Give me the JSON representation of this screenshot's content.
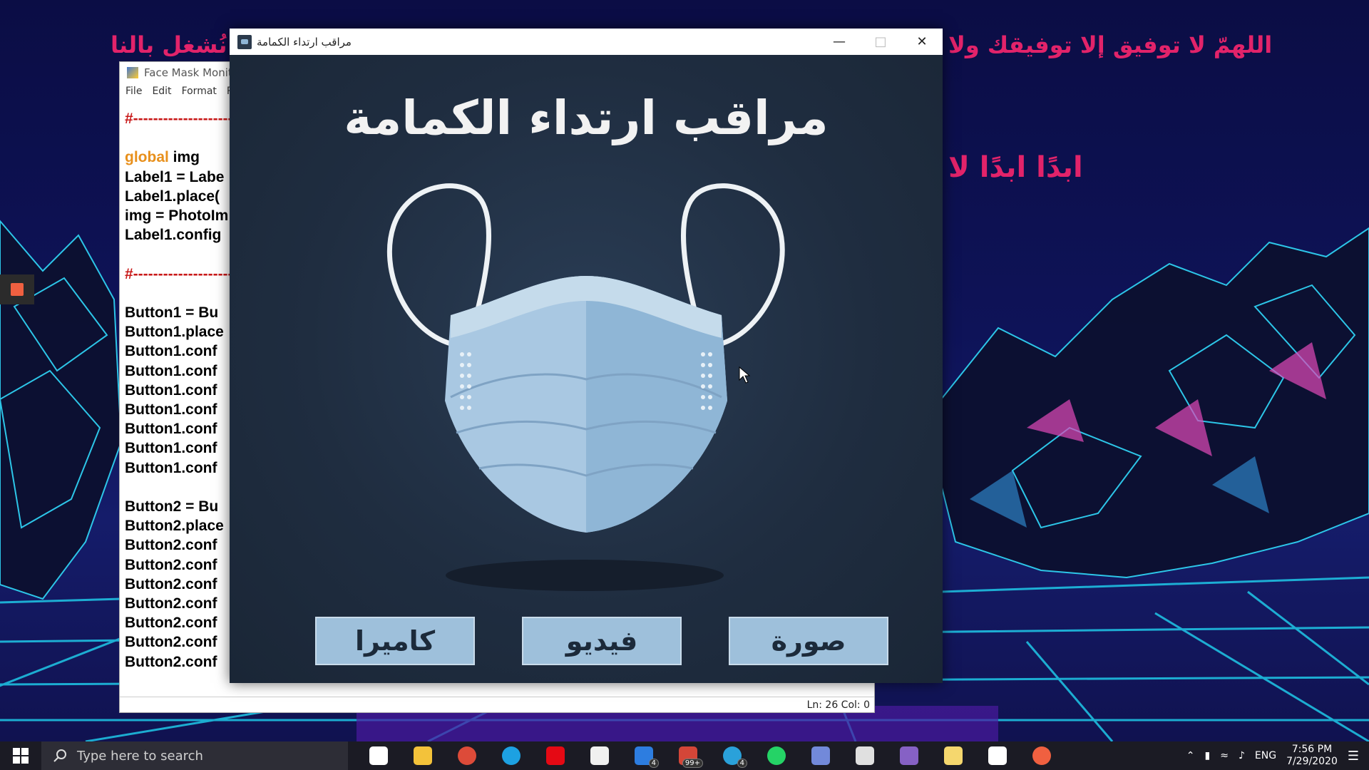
{
  "desktop": {
    "banner_left": "نُشغل بالنا",
    "banner_right": "اللهمّ لا توفيق إلا توفيقك ولا",
    "banner_second": "ابدًا ابدًا لا"
  },
  "editor": {
    "title": "Face Mask Monito",
    "menu": [
      "File",
      "Edit",
      "Format",
      "R"
    ],
    "code_lines": [
      {
        "text": "#------------------------",
        "cls": "cm"
      },
      {
        "text": "",
        "cls": ""
      },
      {
        "text": "global",
        "cls": "kw",
        "rest": " img"
      },
      {
        "text": "Label1 = Labe",
        "cls": ""
      },
      {
        "text": "Label1.place(",
        "cls": ""
      },
      {
        "text": "img = PhotoIm",
        "cls": ""
      },
      {
        "text": "Label1.config",
        "cls": ""
      },
      {
        "text": "",
        "cls": ""
      },
      {
        "text": "#------------------------",
        "cls": "cm"
      },
      {
        "text": "",
        "cls": ""
      },
      {
        "text": "Button1 = Bu",
        "cls": ""
      },
      {
        "text": "Button1.place",
        "cls": ""
      },
      {
        "text": "Button1.conf",
        "cls": ""
      },
      {
        "text": "Button1.conf",
        "cls": ""
      },
      {
        "text": "Button1.conf",
        "cls": ""
      },
      {
        "text": "Button1.conf",
        "cls": ""
      },
      {
        "text": "Button1.conf",
        "cls": ""
      },
      {
        "text": "Button1.conf",
        "cls": ""
      },
      {
        "text": "Button1.conf",
        "cls": ""
      },
      {
        "text": "",
        "cls": ""
      },
      {
        "text": "Button2 = Bu",
        "cls": ""
      },
      {
        "text": "Button2.place",
        "cls": ""
      },
      {
        "text": "Button2.conf",
        "cls": ""
      },
      {
        "text": "Button2.conf",
        "cls": ""
      },
      {
        "text": "Button2.conf",
        "cls": ""
      },
      {
        "text": "Button2.conf",
        "cls": ""
      },
      {
        "text": "Button2.conf",
        "cls": ""
      },
      {
        "text": "Button2.conf",
        "cls": ""
      },
      {
        "text": "Button2.conf",
        "cls": ""
      }
    ],
    "status": "Ln: 26   Col: 0"
  },
  "app": {
    "window_title": "مراقب ارتداء الكمامة",
    "heading": "مراقب ارتداء الكمامة",
    "buttons": {
      "camera": "كاميرا",
      "video": "فيديو",
      "image": "صورة"
    },
    "colors": {
      "background": "#1e2c3e",
      "button": "#9ec0db",
      "mask": "#a9c8e2"
    }
  },
  "taskbar": {
    "search_placeholder": "Type here to search",
    "icons": [
      {
        "name": "task-view-icon",
        "color": "#ffffff",
        "badge": ""
      },
      {
        "name": "file-explorer-icon",
        "color": "#f3c23a",
        "badge": ""
      },
      {
        "name": "chrome-icon",
        "color": "#dd4b39",
        "badge": ""
      },
      {
        "name": "edge-icon",
        "color": "#1da1e2",
        "badge": ""
      },
      {
        "name": "netflix-icon",
        "color": "#e50914",
        "badge": ""
      },
      {
        "name": "store-icon",
        "color": "#f0f0f0",
        "badge": ""
      },
      {
        "name": "mail-icon",
        "color": "#2d7de0",
        "badge": "4"
      },
      {
        "name": "gmail-icon",
        "color": "#d44638",
        "badge": "99+"
      },
      {
        "name": "telegram-icon",
        "color": "#2aa1da",
        "badge": "4"
      },
      {
        "name": "whatsapp-icon",
        "color": "#25d366",
        "badge": ""
      },
      {
        "name": "discord-icon",
        "color": "#7289da",
        "badge": ""
      },
      {
        "name": "python-icon",
        "color": "#e0e0e0",
        "badge": ""
      },
      {
        "name": "visual-studio-icon",
        "color": "#8661c5",
        "badge": ""
      },
      {
        "name": "idle-icon",
        "color": "#f5d76e",
        "badge": ""
      },
      {
        "name": "unity-icon",
        "color": "#ffffff",
        "badge": ""
      },
      {
        "name": "screen-recorder-icon",
        "color": "#f06040",
        "badge": ""
      }
    ],
    "tray": {
      "lang": "ENG",
      "time": "7:56 PM",
      "date": "7/29/2020"
    }
  }
}
